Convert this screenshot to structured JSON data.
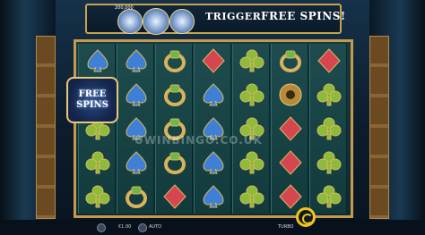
{
  "banner": {
    "trigger_text": "TRIGGER",
    "free_spins_text": "FREE SPINS!",
    "badge_label": "FREE SPINS",
    "balance": "200,000"
  },
  "overlay": {
    "line1": "FREE",
    "line2": "SPINS"
  },
  "watermark": "UWINBINGO.CO.UK",
  "bottom": {
    "bet": "€1.00",
    "auto_label": "AUTO",
    "turbo_label": "TURBO"
  },
  "colors": {
    "frame_gold": "#c59a4c",
    "club_green": "#8dbb3a",
    "spade_blue": "#3f7fd6",
    "diamond_red": "#d6464f",
    "heart_red": "#c43846",
    "spin_yellow": "#f1c419"
  },
  "reels": [
    [
      "spade-symbol",
      "free-spins-symbol",
      "club-symbol",
      "club-symbol",
      "club-symbol"
    ],
    [
      "spade-symbol",
      "spade-symbol",
      "spade-symbol",
      "spade-symbol",
      "ring-symbol"
    ],
    [
      "ring-symbol",
      "ring-symbol",
      "ring-symbol",
      "ring-symbol",
      "diamond-symbol"
    ],
    [
      "diamond-symbol",
      "spade-symbol",
      "spade-symbol",
      "spade-symbol",
      "spade-symbol"
    ],
    [
      "club-symbol",
      "club-symbol",
      "club-symbol",
      "club-symbol",
      "club-symbol"
    ],
    [
      "ring-symbol",
      "eye-symbol",
      "diamond-symbol",
      "diamond-symbol",
      "diamond-symbol"
    ],
    [
      "diamond-symbol",
      "club-symbol",
      "club-symbol",
      "club-symbol",
      "club-symbol"
    ]
  ]
}
